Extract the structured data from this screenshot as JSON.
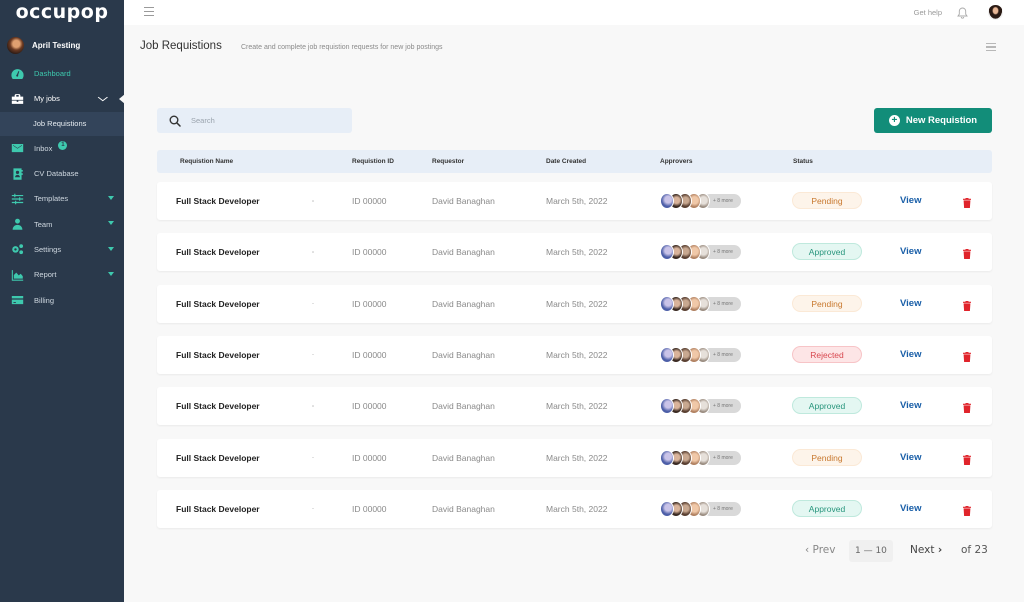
{
  "app": {
    "logo": "occupop"
  },
  "user": {
    "name": "April Testing"
  },
  "sidebar": {
    "items": [
      {
        "label": "Dashboard",
        "icon": "dashboard-icon",
        "active": true
      },
      {
        "label": "My jobs",
        "icon": "briefcase-icon",
        "expanded": true
      },
      {
        "label": "Job Requistions",
        "sub": true
      },
      {
        "label": "Inbox",
        "icon": "envelope-icon",
        "badge": "1"
      },
      {
        "label": "CV Database",
        "icon": "contact-book-icon"
      },
      {
        "label": "Templates",
        "icon": "sliders-icon",
        "dropdown": true
      },
      {
        "label": "Team",
        "icon": "person-icon",
        "dropdown": true
      },
      {
        "label": "Settings",
        "icon": "gears-icon",
        "dropdown": true
      },
      {
        "label": "Report",
        "icon": "chart-area-icon",
        "dropdown": true
      },
      {
        "label": "Billing",
        "icon": "credit-card-icon"
      }
    ]
  },
  "topbar": {
    "help": "Get help"
  },
  "page": {
    "title": "Job Requistions",
    "subtitle": "Create and complete job requistion requests for new job postings"
  },
  "search": {
    "placeholder": "Search",
    "value": ""
  },
  "new_button": {
    "label": "New Requistion"
  },
  "table": {
    "columns": [
      "Requistion Name",
      "Requistion ID",
      "Requestor",
      "Date Created",
      "Approvers",
      "Status"
    ],
    "rows": [
      {
        "name": "Full Stack Developer",
        "id": "ID 00000",
        "requestor": "David Banaghan",
        "date": "March 5th, 2022",
        "more": "+ 8 more",
        "status": "Pending",
        "action": "View"
      },
      {
        "name": "Full Stack Developer",
        "id": "ID 00000",
        "requestor": "David Banaghan",
        "date": "March 5th, 2022",
        "more": "+ 8 more",
        "status": "Approved",
        "action": "View"
      },
      {
        "name": "Full Stack Developer",
        "id": "ID 00000",
        "requestor": "David Banaghan",
        "date": "March 5th, 2022",
        "more": "+ 8 more",
        "status": "Pending",
        "action": "View"
      },
      {
        "name": "Full Stack Developer",
        "id": "ID 00000",
        "requestor": "David Banaghan",
        "date": "March 5th, 2022",
        "more": "+ 8 more",
        "status": "Rejected",
        "action": "View"
      },
      {
        "name": "Full Stack Developer",
        "id": "ID 00000",
        "requestor": "David Banaghan",
        "date": "March 5th, 2022",
        "more": "+ 8 more",
        "status": "Approved",
        "action": "View"
      },
      {
        "name": "Full Stack Developer",
        "id": "ID 00000",
        "requestor": "David Banaghan",
        "date": "March 5th, 2022",
        "more": "+ 8 more",
        "status": "Pending",
        "action": "View"
      },
      {
        "name": "Full Stack Developer",
        "id": "ID 00000",
        "requestor": "David Banaghan",
        "date": "March 5th, 2022",
        "more": "+ 8 more",
        "status": "Approved",
        "action": "View"
      }
    ]
  },
  "pagination": {
    "prev": "Prev",
    "range": "1 — 10",
    "next": "Next",
    "total": "of 23"
  },
  "colors": {
    "sidebar": "#2a394b",
    "accent": "#3ec9ae",
    "primary_button": "#128d79",
    "link": "#1a5fa8",
    "delete": "#e0242b"
  }
}
